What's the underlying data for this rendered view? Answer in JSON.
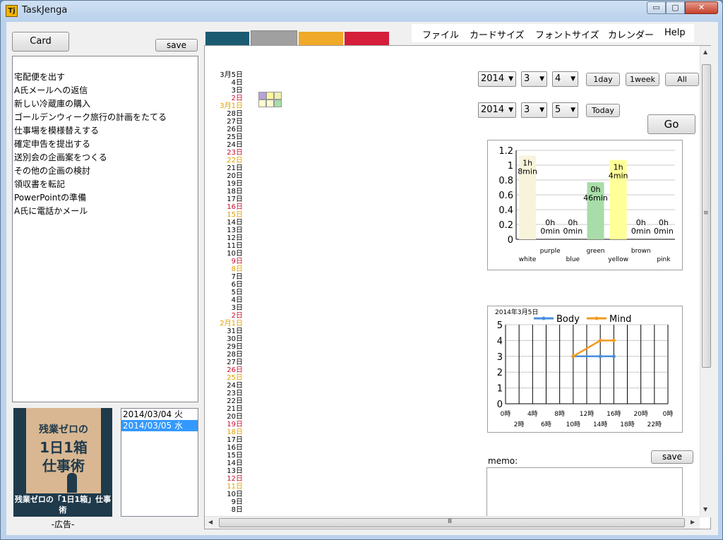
{
  "window": {
    "title": "TaskJenga",
    "icon_text": "Tj",
    "minimize": "▭",
    "maximize": "▢",
    "close": "✕"
  },
  "left": {
    "card_button": "Card",
    "save_button": "save",
    "tasks": [
      "宅配便を出す",
      "A氏メールへの返信",
      "新しい冷蔵庫の購入",
      "ゴールデンウィーク旅行の計画をたてる",
      "仕事場を模様替えする",
      "確定申告を提出する",
      "送別会の企画案をつくる",
      "その他の企画の検討",
      "領収書を転記",
      "PowerPointの準備",
      "A氏に電話かメール"
    ],
    "ad": {
      "cover_line1": "残業ゼロの",
      "cover_line2": "1日1箱",
      "cover_line3": "仕事術",
      "caption": "残業ゼロの「1日1箱」仕事術",
      "label": "-広告-"
    },
    "dates": [
      "2014/03/04 火",
      "2014/03/05 水"
    ]
  },
  "tabs": {
    "colors": [
      "#1b5b72",
      "#a0a0a0",
      "#f0a928",
      "#d41e3a"
    ]
  },
  "menu": [
    "ファイル",
    "カードサイズ",
    "フォントサイズ",
    "カレンダー",
    "Help"
  ],
  "timeline": {
    "labels": [
      "3月5日",
      "4日",
      "3日",
      "2日",
      "3月1日",
      "28日",
      "27日",
      "26日",
      "25日",
      "24日",
      "23日",
      "22日",
      "21日",
      "20日",
      "19日",
      "18日",
      "17日",
      "16日",
      "15日",
      "14日",
      "13日",
      "12日",
      "11日",
      "10日",
      "9日",
      "8日",
      "7日",
      "6日",
      "5日",
      "4日",
      "3日",
      "2日",
      "2月1日",
      "31日",
      "30日",
      "29日",
      "28日",
      "27日",
      "26日",
      "25日",
      "24日",
      "23日",
      "22日",
      "21日",
      "20日",
      "19日",
      "18日",
      "17日",
      "16日",
      "15日",
      "14日",
      "13日",
      "12日",
      "11日",
      "10日",
      "9日",
      "8日"
    ],
    "colors": [
      "#000",
      "#000",
      "#000",
      "#c8102e",
      "#e0a000",
      "#000",
      "#000",
      "#000",
      "#000",
      "#000",
      "#c8102e",
      "#e0a000",
      "#000",
      "#000",
      "#000",
      "#000",
      "#000",
      "#c8102e",
      "#e0a000",
      "#000",
      "#000",
      "#000",
      "#000",
      "#000",
      "#c8102e",
      "#e0a000",
      "#000",
      "#000",
      "#000",
      "#000",
      "#000",
      "#c8102e",
      "#e0a000",
      "#000",
      "#000",
      "#000",
      "#000",
      "#000",
      "#c8102e",
      "#e0a000",
      "#000",
      "#000",
      "#000",
      "#000",
      "#000",
      "#c8102e",
      "#e0a000",
      "#000",
      "#000",
      "#000",
      "#000",
      "#000",
      "#c8102e",
      "#e0a000",
      "#000",
      "#000",
      "#000"
    ],
    "mini_grid_colors": [
      "#b9a1d8",
      "#fff79e",
      "#f0f0b0",
      "#fffbd0",
      "#fffbd0",
      "#a8dca8"
    ]
  },
  "controls": {
    "row1": {
      "year": "2014",
      "month": "3",
      "day": "4",
      "btn_1day": "1day",
      "btn_1week": "1week",
      "btn_all": "All"
    },
    "row2": {
      "year": "2014",
      "month": "3",
      "day": "5",
      "btn_today": "Today"
    },
    "go_button": "Go",
    "arrow": "▼"
  },
  "chart_data": [
    {
      "type": "bar",
      "title": "",
      "categories": [
        "white",
        "purple",
        "blue",
        "green",
        "yellow",
        "brown",
        "pink"
      ],
      "values": [
        1.13,
        0,
        0,
        0.77,
        1.07,
        0,
        0
      ],
      "value_labels": [
        [
          "1h",
          "8min"
        ],
        [
          "0h",
          "0min"
        ],
        [
          "0h",
          "0min"
        ],
        [
          "0h",
          "46min"
        ],
        [
          "1h",
          "4min"
        ],
        [
          "0h",
          "0min"
        ],
        [
          "0h",
          "0min"
        ]
      ],
      "colors": [
        "#f8f4dc",
        "#b9a1d8",
        "#9ec8f0",
        "#a8dca8",
        "#ffff99",
        "#c8a078",
        "#f4b6c8"
      ],
      "ylim": [
        0,
        1.2
      ],
      "yticks": [
        "0",
        "0.2",
        "0.4",
        "0.6",
        "0.8",
        "1",
        "1.2"
      ],
      "grid": true
    },
    {
      "type": "line",
      "title": "2014年3月5日",
      "x_ticks_top": [
        "0時",
        "4時",
        "8時",
        "12時",
        "16時",
        "20時",
        "0時"
      ],
      "x_ticks_bottom": [
        "2時",
        "6時",
        "10時",
        "14時",
        "18時",
        "22時"
      ],
      "ylim": [
        0,
        5
      ],
      "yticks": [
        "0",
        "1",
        "2",
        "3",
        "4",
        "5"
      ],
      "series": [
        {
          "name": "Body",
          "color": "#4a8fdc",
          "x": [
            10,
            14,
            16
          ],
          "values": [
            3,
            3,
            3
          ]
        },
        {
          "name": "Mind",
          "color": "#f39a1e",
          "x": [
            10,
            14,
            16
          ],
          "values": [
            3,
            4,
            4
          ]
        }
      ],
      "legend": "top"
    }
  ],
  "memo": {
    "label": "memo:",
    "save_button": "save"
  },
  "scroll": {
    "up": "▲",
    "down": "▼",
    "left": "◀",
    "right": "▶",
    "grip_v": "≡",
    "grip_h": "Ⅲ"
  }
}
